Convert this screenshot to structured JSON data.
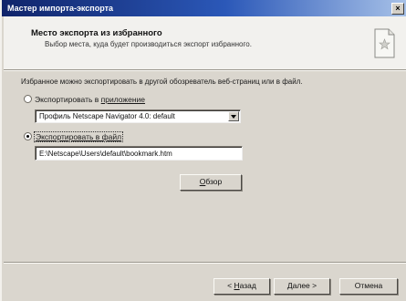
{
  "window": {
    "title": "Мастер импорта-экспорта",
    "close_glyph": "×"
  },
  "header": {
    "title": "Место экспорта из избранного",
    "subtitle": "Выбор места, куда будет производиться экспорт избранного.",
    "icon": "document-star-icon"
  },
  "intro": "Избранное можно экспортировать в другой обозреватель веб-страниц или в файл.",
  "options": {
    "app": {
      "label_prefix": "Экспортировать в ",
      "label_accel": "приложение",
      "selected": false
    },
    "app_select": {
      "value": "Профиль Netscape Navigator 4.0: default"
    },
    "file": {
      "label_accel": "Экспортировать в файл",
      "selected": true
    },
    "file_path": {
      "value": "E:\\Netscape\\Users\\default\\bookmark.htm"
    }
  },
  "buttons": {
    "browse_accel": "О",
    "browse_rest": "бзор",
    "back_prefix": "< ",
    "back_accel": "Н",
    "back_rest": "азад",
    "next": "Далее >",
    "cancel": "Отмена"
  }
}
